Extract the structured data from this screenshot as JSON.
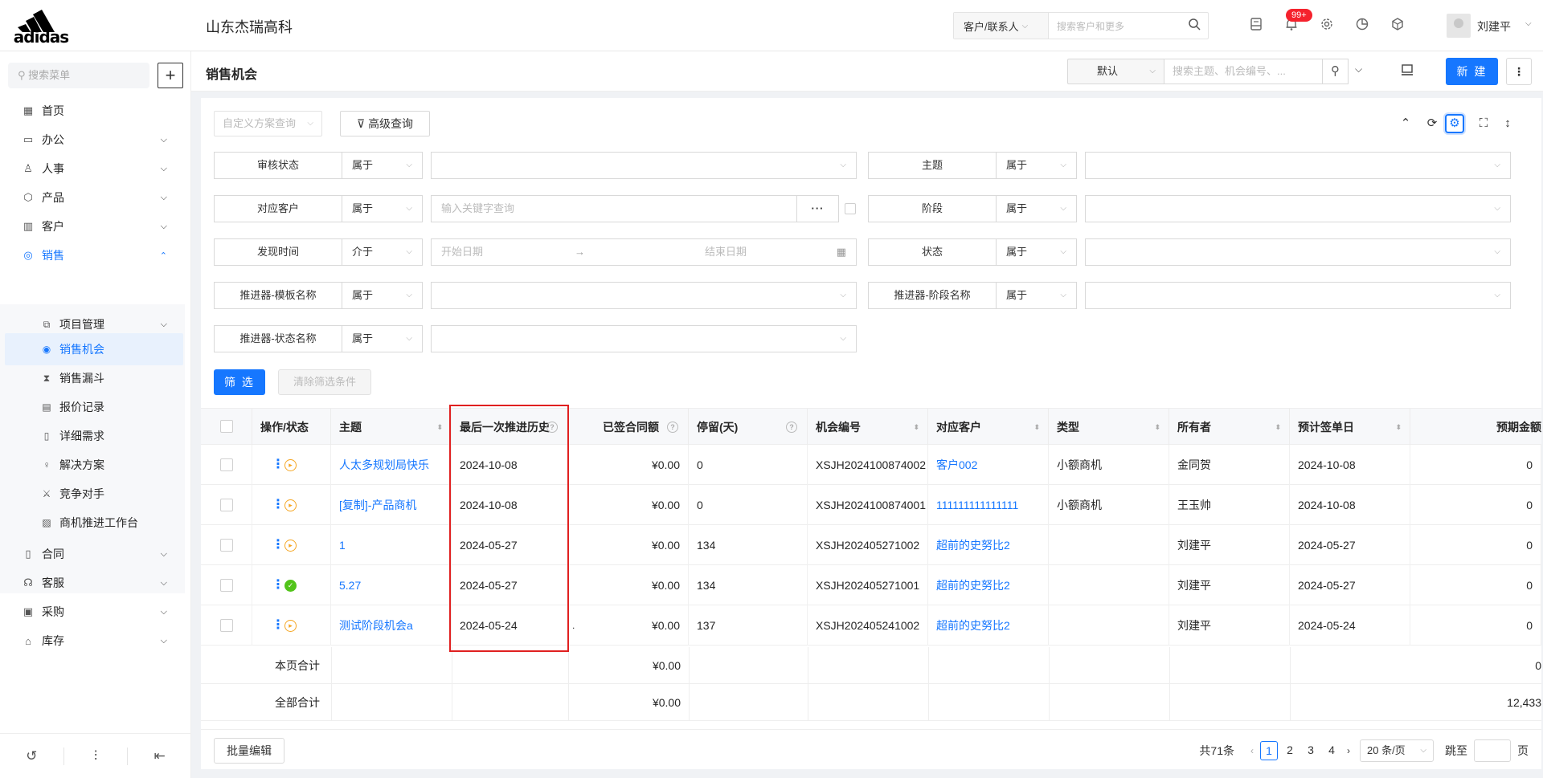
{
  "header": {
    "logo_text": "adidas",
    "company": "山东杰瑞高科",
    "search_scope": "客户/联系人",
    "search_placeholder": "搜索客户和更多",
    "badge": "99+",
    "username": "刘建平"
  },
  "sidebar": {
    "search_placeholder": "搜索菜单",
    "items": [
      {
        "label": "首页"
      },
      {
        "label": "办公"
      },
      {
        "label": "人事"
      },
      {
        "label": "产品"
      },
      {
        "label": "客户"
      },
      {
        "label": "销售"
      }
    ],
    "sales_sub": [
      {
        "label": "项目管理"
      },
      {
        "label": "销售机会"
      },
      {
        "label": "销售漏斗"
      },
      {
        "label": "报价记录"
      },
      {
        "label": "详细需求"
      },
      {
        "label": "解决方案"
      },
      {
        "label": "竞争对手"
      },
      {
        "label": "商机推进工作台"
      }
    ],
    "items_after": [
      {
        "label": "合同"
      },
      {
        "label": "客服"
      },
      {
        "label": "采购"
      },
      {
        "label": "库存"
      }
    ]
  },
  "page": {
    "title": "销售机会",
    "view": "默认",
    "view_search_placeholder": "搜索主题、机会编号、...",
    "new_label": "新 建"
  },
  "filters": {
    "preset_placeholder": "自定义方案查询",
    "advanced_label": "高级查询",
    "rows": [
      {
        "label": "审核状态",
        "op": "属于"
      },
      {
        "label": "主题",
        "op": "属于"
      },
      {
        "label": "对应客户",
        "op": "属于",
        "placeholder": "输入关键字查询"
      },
      {
        "label": "阶段",
        "op": "属于"
      },
      {
        "label": "发现时间",
        "op": "介于",
        "start": "开始日期",
        "end": "结束日期"
      },
      {
        "label": "状态",
        "op": "属于"
      },
      {
        "label": "推进器-模板名称",
        "op": "属于"
      },
      {
        "label": "推进器-阶段名称",
        "op": "属于"
      },
      {
        "label": "推进器-状态名称",
        "op": "属于"
      }
    ],
    "apply_label": "筛 选",
    "clear_label": "清除筛选条件"
  },
  "table": {
    "columns": [
      "操作/状态",
      "主题",
      "最后一次推进历史",
      "已签合同额",
      "停留(天)",
      "机会编号",
      "对应客户",
      "类型",
      "所有者",
      "预计签单日",
      "预期金额"
    ],
    "rows": [
      {
        "status": "pending",
        "subject": "人太多规划局快乐",
        "last": "2024-10-08",
        "amount": "¥0.00",
        "stay": "0",
        "code": "XSJH2024100874002",
        "customer": "客户002",
        "type": "小额商机",
        "owner": "金同贺",
        "date": "2024-10-08",
        "expected": "0"
      },
      {
        "status": "pending",
        "subject": "[复制]-产品商机",
        "last": "2024-10-08",
        "amount": "¥0.00",
        "stay": "0",
        "code": "XSJH2024100874001",
        "customer": "111111111111111",
        "type": "小额商机",
        "owner": "王玉帅",
        "date": "2024-10-08",
        "expected": "0"
      },
      {
        "status": "pending",
        "subject": "1",
        "last": "2024-05-27",
        "amount": "¥0.00",
        "stay": "134",
        "code": "XSJH2024052710​02",
        "customer": "超前的史努比2",
        "type": "",
        "owner": "刘建平",
        "date": "2024-05-27",
        "expected": "0"
      },
      {
        "status": "done",
        "subject": "5.27",
        "last": "2024-05-27",
        "amount": "¥0.00",
        "stay": "134",
        "code": "XSJH2024052710​01",
        "customer": "超前的史努比2",
        "type": "",
        "owner": "刘建平",
        "date": "2024-05-27",
        "expected": "0"
      },
      {
        "status": "pending",
        "subject": "测试阶段机会a",
        "last": "2024-05-24",
        "amount": "¥0.00",
        "stay": "137",
        "code": "XSJH2024052410​02",
        "customer": "超前的史努比2",
        "type": "",
        "owner": "刘建平",
        "date": "2024-05-24",
        "expected": "0"
      }
    ],
    "dot_mark": ".",
    "page_total_label": "本页合计",
    "page_total_amount": "¥0.00",
    "page_total_expected": "0",
    "all_total_label": "全部合计",
    "all_total_amount": "¥0.00",
    "all_total_expected": "12,433"
  },
  "footer": {
    "batch_label": "批量编辑",
    "total": "共71条",
    "pages": [
      "1",
      "2",
      "3",
      "4"
    ],
    "page_size": "20 条/页",
    "jump_label": "跳至",
    "page_unit": "页"
  }
}
